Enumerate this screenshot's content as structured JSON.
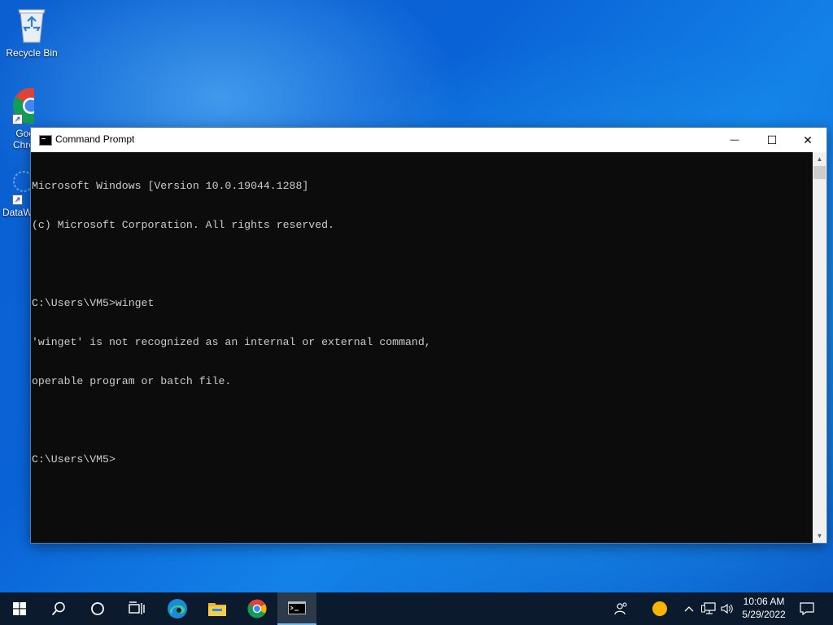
{
  "desktop": {
    "icons": [
      {
        "label": "Recycle Bin",
        "icon": "recycle-bin-icon"
      },
      {
        "label": "Goo\nChro",
        "icon": "chrome-icon"
      },
      {
        "label": "DataW",
        "icon": "datawrapper-icon"
      }
    ]
  },
  "window": {
    "title": "Command Prompt",
    "controls": {
      "minimize": "—",
      "maximize": "☐",
      "close": "✕"
    }
  },
  "console": {
    "lines": [
      "Microsoft Windows [Version 10.0.19044.1288]",
      "(c) Microsoft Corporation. All rights reserved.",
      "",
      "C:\\Users\\VM5>winget",
      "'winget' is not recognized as an internal or external command,",
      "operable program or batch file.",
      "",
      "C:\\Users\\VM5>"
    ]
  },
  "taskbar": {
    "items": [
      "start-icon",
      "search-icon",
      "cortana-icon",
      "task-view-icon",
      "edge-icon",
      "file-explorer-icon",
      "chrome-icon",
      "command-prompt-icon"
    ],
    "clock": {
      "time": "10:06 AM",
      "date": "5/29/2022"
    }
  },
  "colors": {
    "console_bg": "#0c0c0c",
    "console_text": "#cccccc",
    "taskbar_bg": "#0b1a2c",
    "desktop_blue": "#0a63d6"
  }
}
